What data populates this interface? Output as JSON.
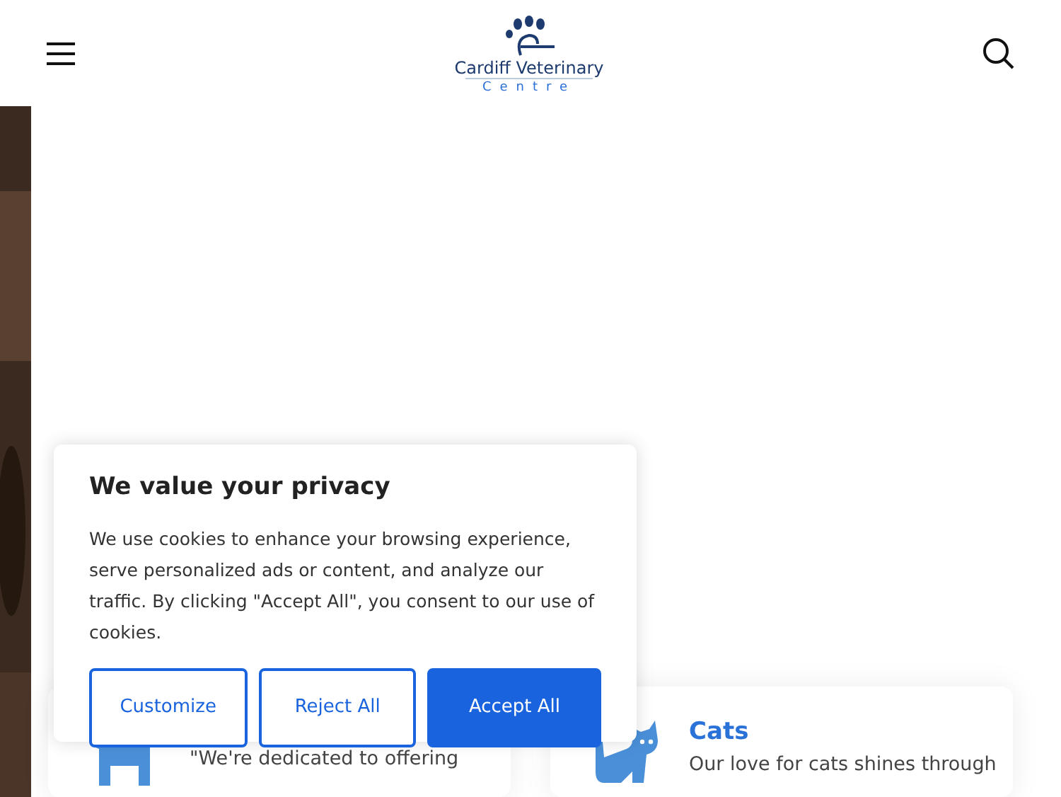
{
  "logo": {
    "name": "Cardiff Veterinary",
    "subtitle": "Centre"
  },
  "cards": [
    {
      "kind": "dog",
      "text": "\"We're dedicated to offering"
    },
    {
      "kind": "cat",
      "title": "Cats",
      "text": "Our love for cats shines through"
    }
  ],
  "cookie_banner": {
    "title": "We value your privacy",
    "text": "We use cookies to enhance your browsing experience, serve personalized ads or content, and analyze our traffic. By clicking \"Accept All\", you consent to our use of cookies.",
    "buttons": [
      {
        "label": "Customize",
        "kind": "outline"
      },
      {
        "label": "Reject All",
        "kind": "outline"
      },
      {
        "label": "Accept All",
        "kind": "primary"
      }
    ]
  }
}
